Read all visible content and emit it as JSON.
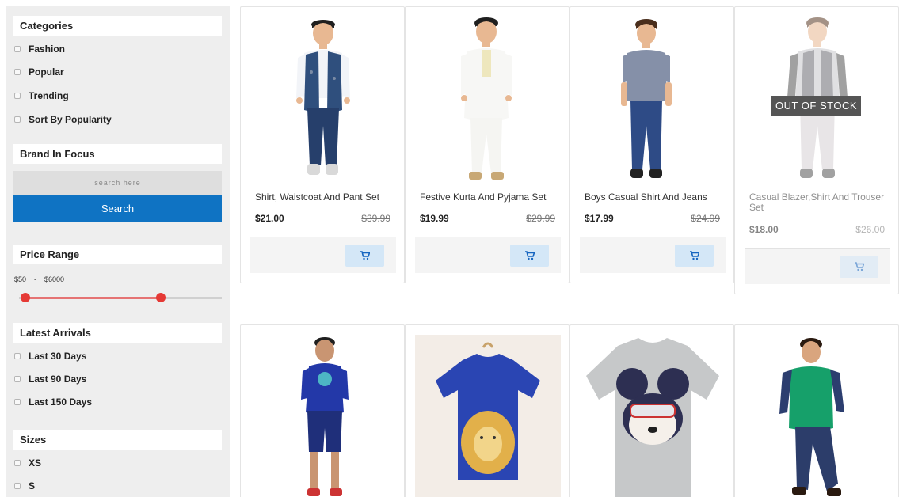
{
  "sidebar": {
    "categories": {
      "title": "Categories",
      "items": [
        "Fashion",
        "Popular",
        "Trending",
        "Sort By Popularity"
      ]
    },
    "brand": {
      "title": "Brand In Focus",
      "search_placeholder": "search here",
      "search_button": "Search"
    },
    "price": {
      "title": "Price Range",
      "min_label": "$50",
      "separator": "-",
      "max_label": "$6000",
      "slider_low": 0.03,
      "slider_high": 0.7
    },
    "arrivals": {
      "title": "Latest Arrivals",
      "items": [
        "Last 30 Days",
        "Last 90 Days",
        "Last 150 Days"
      ]
    },
    "sizes": {
      "title": "Sizes",
      "items": [
        "XS",
        "S"
      ]
    }
  },
  "products": [
    {
      "name": "Shirt, Waistcoat And Pant Set",
      "price": "$21.00",
      "old_price": "$39.99",
      "icon": "cart-icon"
    },
    {
      "name": "Festive Kurta And Pyjama Set",
      "price": "$19.99",
      "old_price": "$29.99",
      "icon": "cart-icon"
    },
    {
      "name": "Boys Casual Shirt And Jeans",
      "price": "$17.99",
      "old_price": "$24.99",
      "icon": "cart-icon"
    },
    {
      "name": "Casual Blazer,Shirt And Trouser Set",
      "price": "$18.00",
      "old_price": "$26.00",
      "badge": "OUT OF STOCK",
      "icon": "cart-icon"
    }
  ],
  "colors": {
    "accent": "#0f73c3",
    "slider": "#e53935",
    "sidebar_bg": "#eeeeee"
  }
}
